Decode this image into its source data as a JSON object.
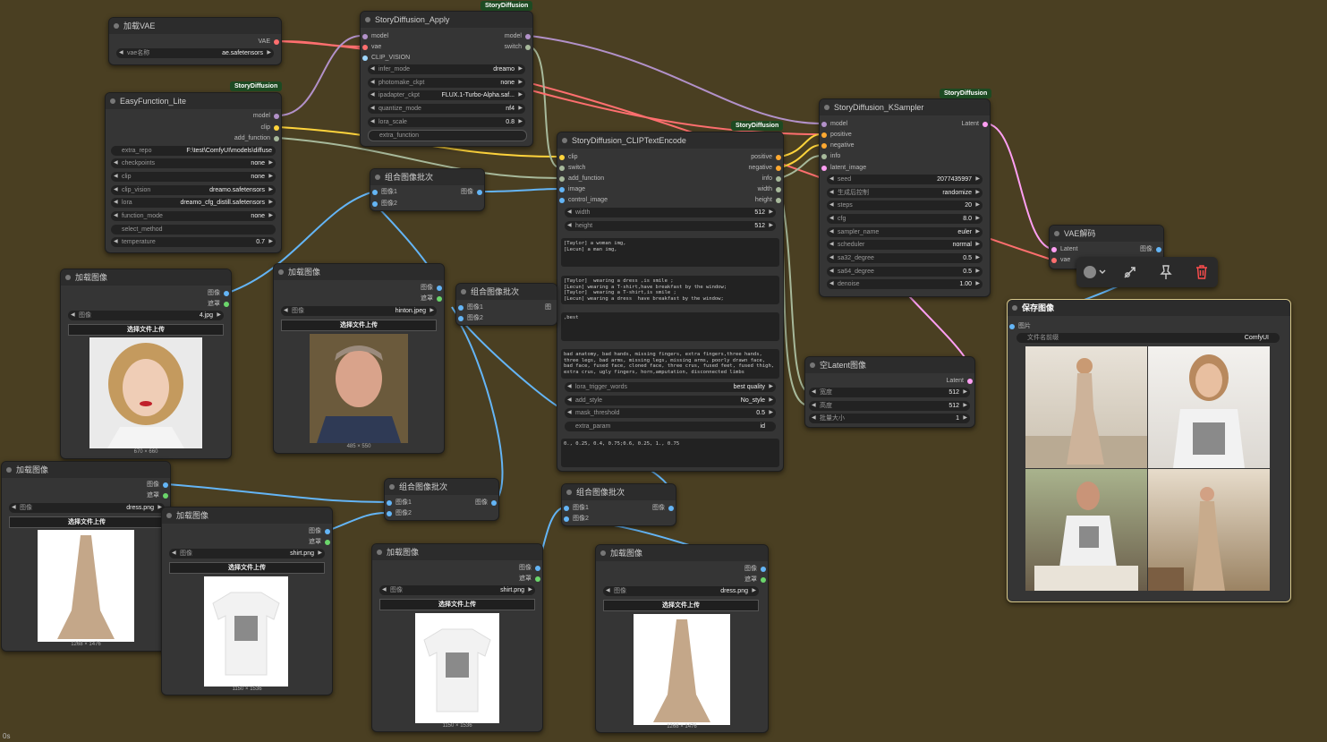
{
  "colors": {
    "bg": "#4a3f22",
    "node": "#353535",
    "widget": "#222222",
    "badge": "#1d4a22",
    "wire_model": "#b291c9",
    "wire_vae": "#ff6f6f",
    "wire_clip": "#ffd43c",
    "wire_image": "#64b5f6",
    "wire_misc": "#a7b99b",
    "wire_latent": "#ff9ff3"
  },
  "badge_label": "StoryDiffusion",
  "status": "0s",
  "nodes": {
    "load_vae": {
      "title": "加载VAE",
      "out_vae": "VAE",
      "w_label": "vae名称",
      "w_value": "ae.safetensors"
    },
    "easy": {
      "title": "EasyFunction_Lite",
      "outs": [
        "model",
        "clip",
        "add_function"
      ],
      "widgets": [
        {
          "label": "extra_repo",
          "value": "F:\\test\\ComfyUI\\models\\diffuse"
        },
        {
          "label": "checkpoints",
          "value": "none"
        },
        {
          "label": "clip",
          "value": "none"
        },
        {
          "label": "clip_vision",
          "value": "dreamo.safetensors"
        },
        {
          "label": "lora",
          "value": "dreamo_cfg_distill.safetensors"
        },
        {
          "label": "function_mode",
          "value": "none"
        },
        {
          "label": "select_method",
          "value": ""
        },
        {
          "label": "temperature",
          "value": "0.7"
        }
      ]
    },
    "apply": {
      "title": "StoryDiffusion_Apply",
      "ins": [
        "model",
        "vae",
        "CLIP_VISION"
      ],
      "outs": [
        "model",
        "switch"
      ],
      "widgets": [
        {
          "label": "infer_mode",
          "value": "dreamo"
        },
        {
          "label": "photomake_ckpt",
          "value": "none"
        },
        {
          "label": "ipadapter_ckpt",
          "value": "FLUX.1-Turbo-Alpha.saf..."
        },
        {
          "label": "quantize_mode",
          "value": "nf4"
        },
        {
          "label": "lora_scale",
          "value": "0.8"
        },
        {
          "label": "extra_function",
          "value": ""
        }
      ]
    },
    "encode": {
      "title": "StoryDiffusion_CLIPTextEncode",
      "ins": [
        "clip",
        "switch",
        "add_function",
        "image",
        "control_image"
      ],
      "outs": [
        "positive",
        "negative",
        "info",
        "width",
        "height"
      ],
      "widgets": [
        {
          "label": "width",
          "value": "512"
        },
        {
          "label": "height",
          "value": "512"
        }
      ],
      "text1": "[Taylor] a woman img,\n[Lecun] a man img,",
      "text2": "[Taylor]  wearing a dress ,is smile ;\n[Lecun] wearing a T-shirt,have breakfast by the window;\n[Taylor]  wearing a T-shirt,is smile ;\n[Lecun] wearing a dress  have breakfast by the window;",
      "text3": ",best",
      "text4": "bad anatomy, bad hands, missing fingers, extra fingers,three hands, three legs, bad arms, missing legs, missing arms, poorly drawn face, bad face, fused face, cloned face, three crus, fused feet, fused thigh, extra crus, ugly fingers, horn,amputation, disconnected limbs",
      "widgets2": [
        {
          "label": "lora_trigger_words",
          "value": "best quality"
        },
        {
          "label": "add_style",
          "value": "No_style"
        },
        {
          "label": "mask_threshold",
          "value": "0.5"
        },
        {
          "label": "extra_param",
          "value": "id"
        }
      ],
      "text5": "0., 0.25, 0.4, 0.75;0.6, 0.25, 1., 0.75"
    },
    "ksampler": {
      "title": "StoryDiffusion_KSampler",
      "ins": [
        "model",
        "positive",
        "negative",
        "info",
        "latent_image"
      ],
      "out": "Latent",
      "widgets": [
        {
          "label": "seed",
          "value": "2077435997"
        },
        {
          "label": "生成后控制",
          "value": "randomize"
        },
        {
          "label": "steps",
          "value": "20"
        },
        {
          "label": "cfg",
          "value": "8.0"
        },
        {
          "label": "sampler_name",
          "value": "euler"
        },
        {
          "label": "scheduler",
          "value": "normal"
        },
        {
          "label": "sa32_degree",
          "value": "0.5"
        },
        {
          "label": "sa64_degree",
          "value": "0.5"
        },
        {
          "label": "denoise",
          "value": "1.00"
        }
      ]
    },
    "vae_decode": {
      "title": "VAE解码",
      "ins": [
        "Latent",
        "vae"
      ],
      "out": "图像"
    },
    "save": {
      "title": "保存图像",
      "in": "图片",
      "w_label": "文件名前缀",
      "w_value": "ComfyUI"
    },
    "empty_latent": {
      "title": "空Latent图像",
      "out": "Latent",
      "widgets": [
        {
          "label": "宽度",
          "value": "512"
        },
        {
          "label": "高度",
          "value": "512"
        },
        {
          "label": "批量大小",
          "value": "1"
        }
      ]
    },
    "batch1": {
      "title": "组合图像批次",
      "ins": [
        "图像1",
        "图像2"
      ],
      "out": "图像"
    },
    "batch2": {
      "title": "组合图像批次",
      "ins": [
        "图像1",
        "图像2"
      ],
      "out": "图"
    },
    "batch3": {
      "title": "组合图像批次",
      "ins": [
        "图像1",
        "图像2"
      ],
      "out": "图像"
    },
    "batch4": {
      "title": "组合图像批次",
      "ins": [
        "图像1",
        "图像2"
      ],
      "out": "图像"
    },
    "load1": {
      "title": "加载图像",
      "outs": [
        "图像",
        "遮罩"
      ],
      "w_label": "图像",
      "w_value": "4.jpg",
      "upload": "选择文件上传",
      "dims": "670 × 660"
    },
    "load2": {
      "title": "加载图像",
      "outs": [
        "图像",
        "遮罩"
      ],
      "w_label": "图像",
      "w_value": "hinton.jpeg",
      "upload": "选择文件上传",
      "dims": "485 × 550"
    },
    "load3": {
      "title": "加载图像",
      "outs": [
        "图像",
        "遮罩"
      ],
      "w_label": "图像",
      "w_value": "dress.png",
      "upload": "选择文件上传",
      "dims": "1268 × 1476"
    },
    "load4": {
      "title": "加载图像",
      "outs": [
        "图像",
        "遮罩"
      ],
      "w_label": "图像",
      "w_value": "shirt.png",
      "upload": "选择文件上传",
      "dims": "1150 × 1536"
    },
    "load5": {
      "title": "加载图像",
      "outs": [
        "图像",
        "遮罩"
      ],
      "w_label": "图像",
      "w_value": "shirt.png",
      "upload": "选择文件上传",
      "dims": "1150 × 1536"
    },
    "load6": {
      "title": "加载图像",
      "outs": [
        "图像",
        "遮罩"
      ],
      "w_label": "图像",
      "w_value": "dress.png",
      "upload": "选择文件上传",
      "dims": "1268 × 1476"
    }
  },
  "toolbar": {
    "items": [
      "color-icon",
      "bypass-icon",
      "pin-icon",
      "delete-icon"
    ]
  }
}
